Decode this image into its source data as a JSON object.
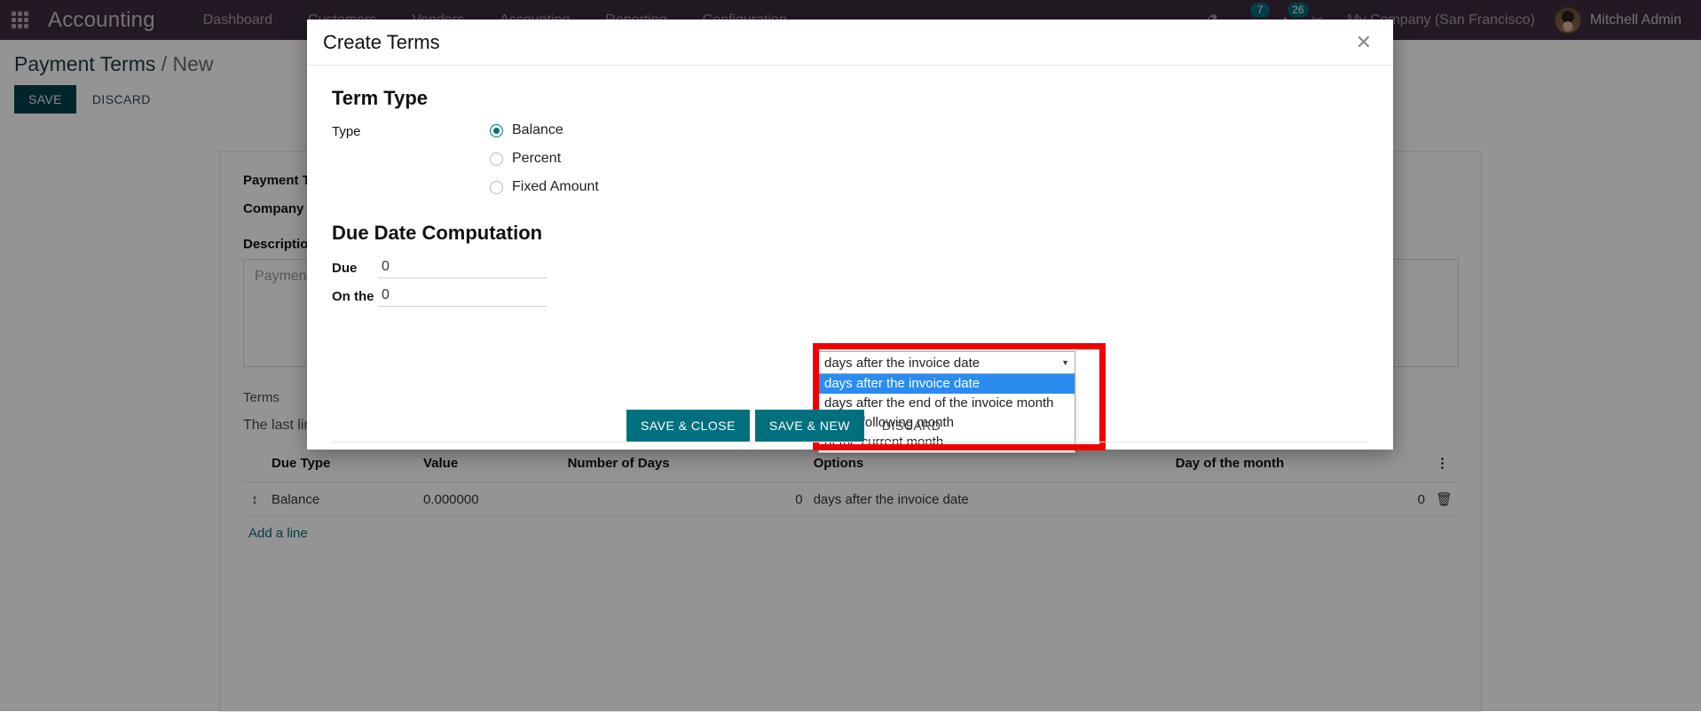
{
  "navbar": {
    "apps_icon": "apps-grid-icon",
    "brand": "Accounting",
    "menu": [
      {
        "label": "Dashboard"
      },
      {
        "label": "Customers"
      },
      {
        "label": "Vendors"
      },
      {
        "label": "Accounting"
      },
      {
        "label": "Reporting"
      },
      {
        "label": "Configuration"
      }
    ],
    "icons": [
      {
        "name": "bug-icon",
        "glyph": "⚗",
        "badge": ""
      },
      {
        "name": "messages-icon",
        "glyph": "☁",
        "badge": "7"
      },
      {
        "name": "activities-icon",
        "glyph": "◔",
        "badge": "26"
      },
      {
        "name": "scissors-icon",
        "glyph": "✂",
        "badge": ""
      }
    ],
    "company": "My Company (San Francisco)",
    "user": "Mitchell Admin",
    "avatar_name": "avatar"
  },
  "breadcrumb": {
    "root": "Payment Terms",
    "separator": "/",
    "current": "New"
  },
  "actions": {
    "save": "SAVE",
    "discard": "DISCARD"
  },
  "form": {
    "payment_terms_label": "Payment Terms",
    "company_label": "Company",
    "description_label": "Description on the Invoice",
    "description_placeholder": "Payment terms explanation for the customer..."
  },
  "terms_section": {
    "label": "Terms",
    "hint": "The last line's computation type should be \"Balance\" to ensure that the whole amount will be allocated.",
    "columns": [
      "Due Type",
      "Value",
      "Number of Days",
      "Options",
      "Day of the month"
    ],
    "rows": [
      {
        "due_type": "Balance",
        "value": "0.000000",
        "number_of_days": "0",
        "options": "days after the invoice date",
        "day_of_month": "0"
      }
    ],
    "add_line": "Add a line",
    "optional_columns_icon": "vertical-dots-icon",
    "delete_icon": "trash-icon"
  },
  "modal": {
    "title": "Create Terms",
    "close_icon": "close-icon",
    "term_type": {
      "heading": "Term Type",
      "field_label": "Type",
      "options": [
        {
          "label": "Balance",
          "selected": true
        },
        {
          "label": "Percent",
          "selected": false
        },
        {
          "label": "Fixed Amount",
          "selected": false
        }
      ]
    },
    "due_date": {
      "heading": "Due Date Computation",
      "due_label": "Due",
      "due_value": "0",
      "on_the_label": "On the",
      "on_the_value": "0",
      "select": {
        "name": "due-date-option-select",
        "value": "days after the invoice date",
        "caret_icon": "chevron-down-icon",
        "options": [
          {
            "label": "days after the invoice date",
            "selected": true
          },
          {
            "label": "days after the end of the invoice month",
            "selected": false
          },
          {
            "label": "of the following month",
            "selected": false
          },
          {
            "label": "of the current month",
            "selected": false
          }
        ]
      }
    },
    "footer": {
      "save_close": "SAVE & CLOSE",
      "save_new": "SAVE & NEW",
      "discard": "DISCARD"
    }
  },
  "colors": {
    "navbar_bg": "#3c2c3e",
    "accent_teal": "#00707f",
    "highlight_red": "#f20000",
    "option_highlight": "#2a8cf0"
  }
}
